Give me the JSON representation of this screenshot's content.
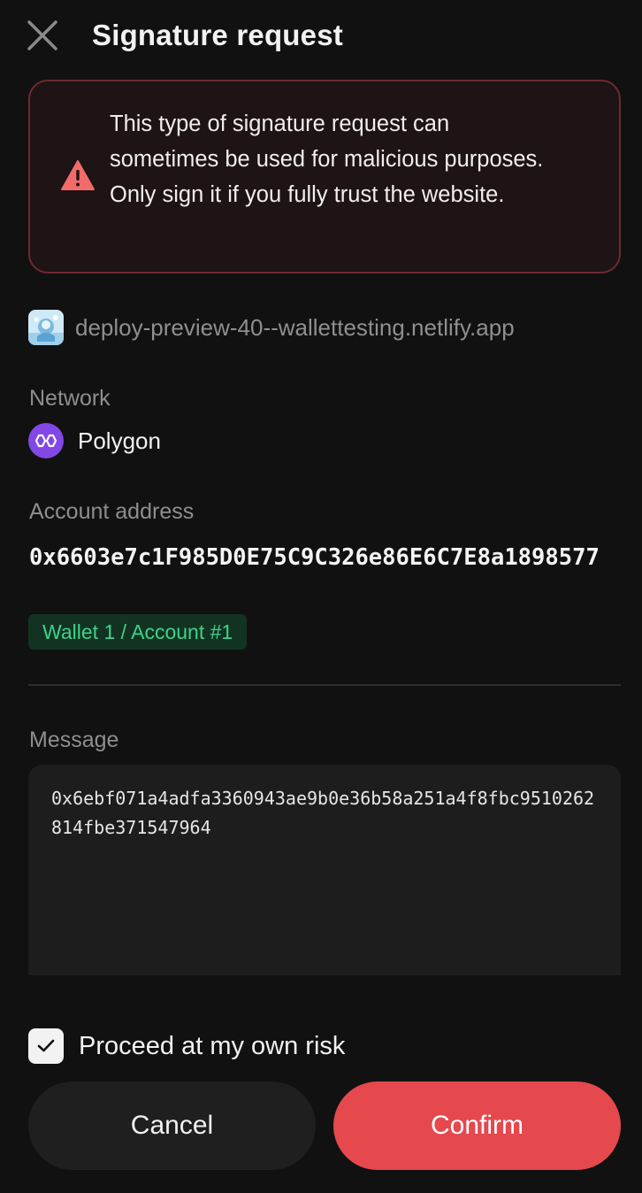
{
  "header": {
    "title": "Signature request",
    "close_icon": "close-icon"
  },
  "warning": {
    "icon": "warning-triangle-icon",
    "text": "This type of signature request can sometimes be used for malicious purposes. Only sign it if you fully trust the website."
  },
  "origin": {
    "icon": "site-logo",
    "url": "deploy-preview-40--wallettesting.netlify.app"
  },
  "network": {
    "label": "Network",
    "icon": "polygon-icon",
    "name": "Polygon"
  },
  "account": {
    "label": "Account address",
    "address": "0x6603e7c1F985D0E75C9C326e86E6C7E8a1898577",
    "badge": "Wallet 1 / Account #1"
  },
  "message": {
    "label": "Message",
    "value": "0x6ebf071a4adfa3360943ae9b0e36b58a251a4f8fbc9510262814fbe371547964"
  },
  "proceed": {
    "label": "Proceed at my own risk",
    "checked": true
  },
  "actions": {
    "cancel_label": "Cancel",
    "confirm_label": "Confirm"
  },
  "colors": {
    "background": "#111111",
    "warning_border": "#6e2a30",
    "warning_icon": "#f26b6b",
    "badge_text": "#3ed28a",
    "confirm": "#e5484d",
    "polygon": "#8247e5"
  }
}
